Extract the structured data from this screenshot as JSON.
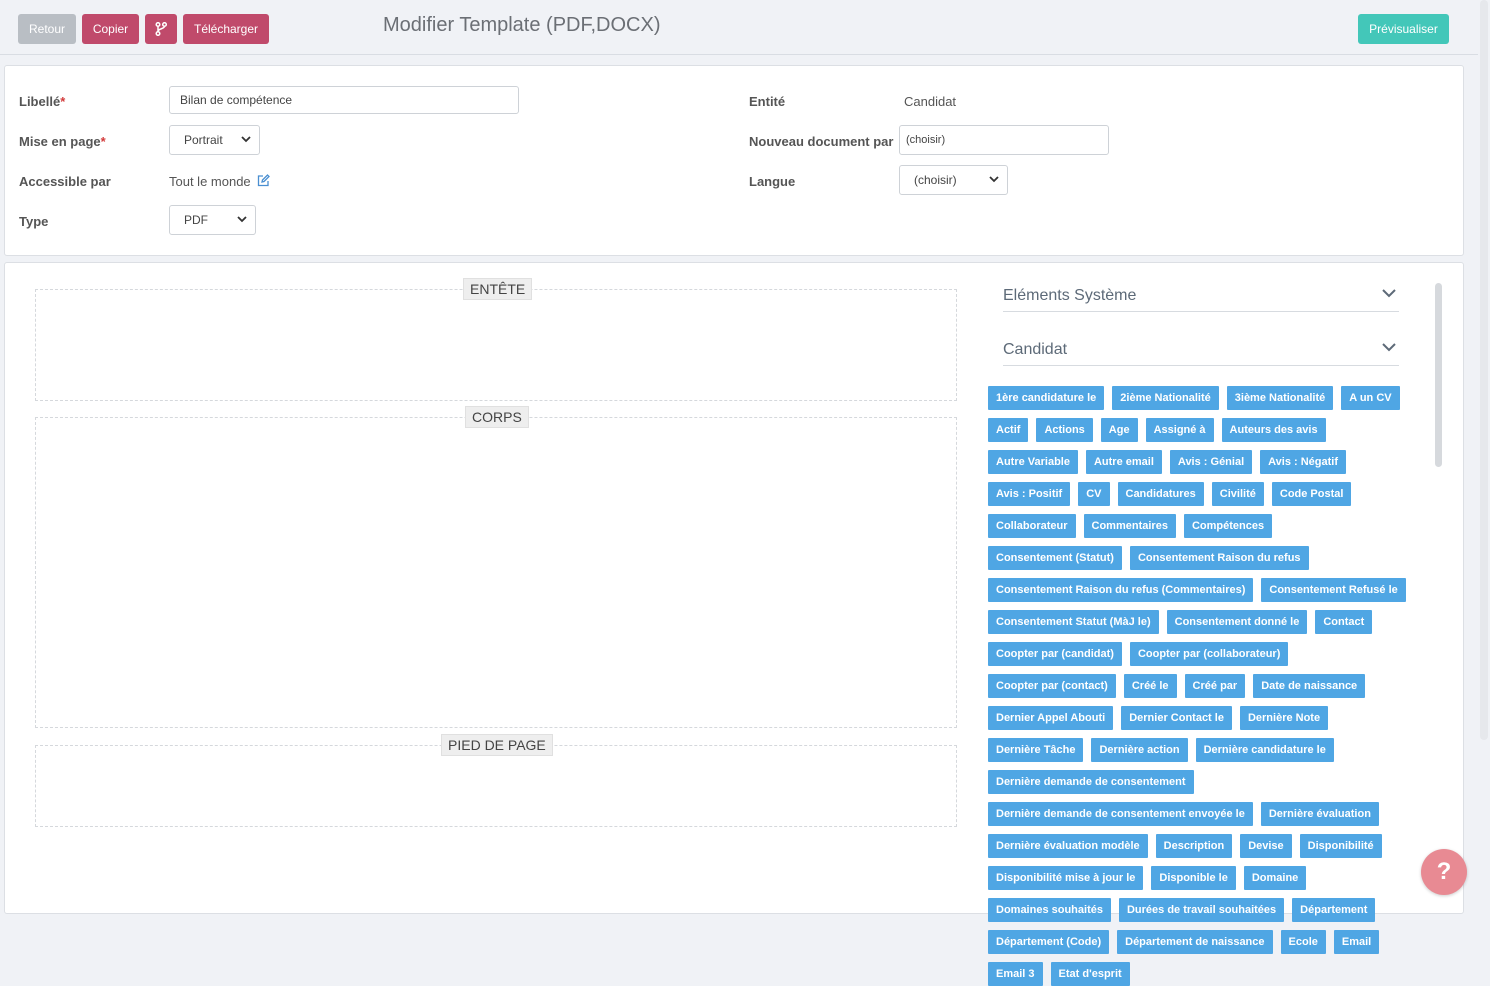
{
  "toolbar": {
    "back_label": "Retour",
    "copy_label": "Copier",
    "download_label": "Télécharger",
    "title": "Modifier Template (PDF,DOCX)",
    "preview_label": "Prévisualiser"
  },
  "form": {
    "libelle": {
      "label": "Libellé",
      "required": "*",
      "value": "Bilan de compétence"
    },
    "mise_en_page": {
      "label": "Mise en page",
      "required": "*",
      "value": "Portrait"
    },
    "accessible_par": {
      "label": "Accessible par",
      "value": "Tout le monde"
    },
    "type": {
      "label": "Type",
      "value": "PDF"
    },
    "entite": {
      "label": "Entité",
      "value": "Candidat"
    },
    "nouveau_document_par": {
      "label": "Nouveau document par",
      "placeholder": "(choisir)"
    },
    "langue": {
      "label": "Langue",
      "value": "(choisir)"
    }
  },
  "editor": {
    "header_label": "ENTÊTE",
    "body_label": "CORPS",
    "footer_label": "PIED DE PAGE"
  },
  "sidebar": {
    "system_title": "Eléments Système",
    "candidate_title": "Candidat",
    "tags": [
      "1ère candidature le",
      "2ième Nationalité",
      "3ième Nationalité",
      "A un CV",
      "Actif",
      "Actions",
      "Age",
      "Assigné à",
      "Auteurs des avis",
      "Autre Variable",
      "Autre email",
      "Avis : Génial",
      "Avis : Négatif",
      "Avis : Positif",
      "CV",
      "Candidatures",
      "Civilité",
      "Code Postal",
      "Collaborateur",
      "Commentaires",
      "Compétences",
      "Consentement (Statut)",
      "Consentement Raison du refus",
      "Consentement Raison du refus (Commentaires)",
      "Consentement Refusé le",
      "Consentement Statut (MàJ le)",
      "Consentement donné le",
      "Contact",
      "Coopter par (candidat)",
      "Coopter par (collaborateur)",
      "Coopter par (contact)",
      "Créé le",
      "Créé par",
      "Date de naissance",
      "Dernier Appel Abouti",
      "Dernier Contact le",
      "Dernière Note",
      "Dernière Tâche",
      "Dernière action",
      "Dernière candidature le",
      "Dernière demande de consentement",
      "Dernière demande de consentement envoyée le",
      "Dernière évaluation",
      "Dernière évaluation modèle",
      "Description",
      "Devise",
      "Disponibilité",
      "Disponibilité mise à jour le",
      "Disponible le",
      "Domaine",
      "Domaines souhaités",
      "Durées de travail souhaitées",
      "Département",
      "Département (Code)",
      "Département de naissance",
      "Ecole",
      "Email",
      "Email 3",
      "Etat d'esprit"
    ]
  },
  "help": {
    "label": "?"
  }
}
